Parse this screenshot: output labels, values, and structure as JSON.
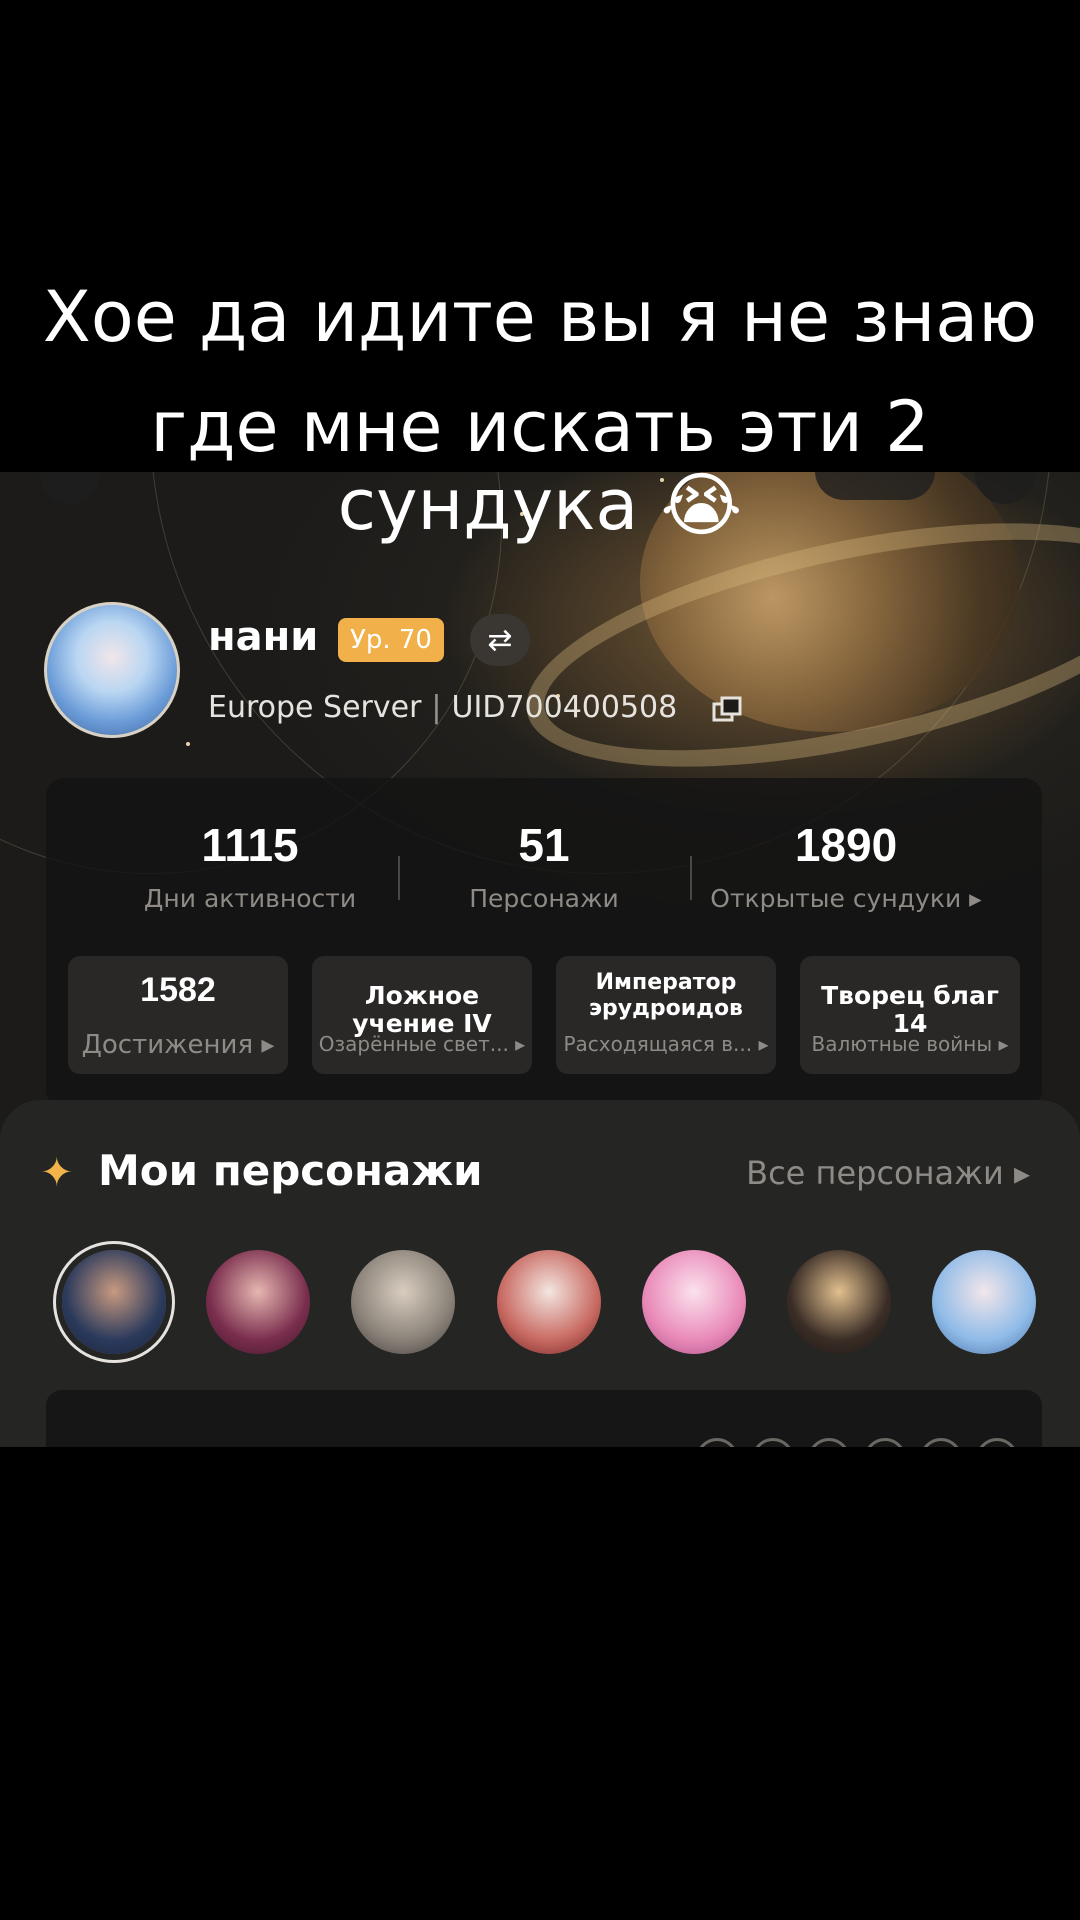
{
  "caption": {
    "line1": "Хое да идите вы я не знаю",
    "line2": "где мне искать эти 2",
    "line3": "сундука 😭"
  },
  "profile": {
    "nickname": "нани",
    "level": "Ур. 70",
    "server": "Europe Server",
    "separator": "|",
    "uid": "UID700400508"
  },
  "stats": [
    {
      "value": "1115",
      "label": "Дни активности"
    },
    {
      "value": "51",
      "label": "Персонажи"
    },
    {
      "value": "1890",
      "label": "Открытые сундуки ▸"
    }
  ],
  "cards": [
    {
      "title": "1582",
      "subtitle": "Достижения ▸"
    },
    {
      "title": "Ложное учение IV",
      "subtitle": "Озарённые свет... ▸"
    },
    {
      "title": "Император эрудроидов",
      "subtitle": "Расходящаяся в... ▸"
    },
    {
      "title": "Творец благ 14",
      "subtitle": "Валютные войны ▸"
    }
  ],
  "characters": {
    "title": "Мои персонажи",
    "all_link": "Все персонажи ▸"
  },
  "colors": {
    "accent": "#f1b04a",
    "background": "#000000",
    "panel": "#252524"
  }
}
